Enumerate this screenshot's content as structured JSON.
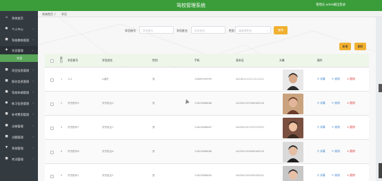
{
  "header": {
    "title": "驾校管理系统",
    "user": "管理员 admin",
    "logout": "退出登录"
  },
  "sidebar": {
    "items": [
      {
        "icon": "home-icon",
        "glyph": "⌂",
        "label": "系统首页",
        "arrow": ""
      },
      {
        "icon": "person-icon",
        "glyph": "●",
        "label": "个人中心",
        "arrow": "›"
      },
      {
        "icon": "book-icon",
        "glyph": "■",
        "label": "驾校教练管理",
        "arrow": "›"
      },
      {
        "icon": "students-icon",
        "glyph": "◆",
        "label": "学员管理",
        "arrow": "⌄"
      },
      {
        "sub": true,
        "label": "学员"
      },
      {
        "icon": "list-icon",
        "glyph": "■",
        "label": "项目信息管理",
        "arrow": "›"
      },
      {
        "icon": "list-icon",
        "glyph": "■",
        "label": "报名信息管理",
        "arrow": "›"
      },
      {
        "icon": "list-icon",
        "glyph": "■",
        "label": "驾校车辆管理",
        "arrow": "›"
      },
      {
        "icon": "pin-icon",
        "glyph": "●",
        "label": "练习信息管理",
        "arrow": "›"
      },
      {
        "icon": "bookmark-icon",
        "glyph": "■",
        "label": "补考费用管理",
        "arrow": "›"
      },
      {
        "icon": "exam-icon",
        "glyph": "■",
        "label": "试卷管理",
        "arrow": "›"
      },
      {
        "icon": "exam-icon",
        "glyph": "■",
        "label": "试题管理",
        "arrow": "›"
      },
      {
        "icon": "settings-icon",
        "glyph": "▼",
        "label": "系统管理",
        "arrow": "›"
      },
      {
        "icon": "exam-icon",
        "glyph": "■",
        "label": "考试管理",
        "arrow": "›"
      }
    ]
  },
  "breadcrumb": {
    "home": "系统首页",
    "sep": "/",
    "current": "学员"
  },
  "search": {
    "fields": [
      {
        "label": "学员账号",
        "placeholder": "学员账号"
      },
      {
        "label": "学员姓名",
        "placeholder": "学员姓名"
      },
      {
        "label": "性别",
        "placeholder": "请选择性别"
      }
    ],
    "button": "查询"
  },
  "actions": {
    "add": "新增",
    "delete": "删除"
  },
  "table": {
    "headers": [
      "索引",
      "学员账号",
      "学员姓名",
      "性别",
      "手机",
      "身份证",
      "头像",
      "操作"
    ],
    "row_actions": {
      "view": "详情",
      "edit": "修改",
      "delete": "删除"
    },
    "rows": [
      {
        "index": "1",
        "account": "111",
        "name": "A演员",
        "gender": "男",
        "phone": "13899999999",
        "id": "441621111111111111"
      },
      {
        "index": "2",
        "account": "学员账号5",
        "name": "学员姓名5",
        "gender": "男",
        "phone": "13823888888",
        "id": "440300199908080000"
      },
      {
        "index": "3",
        "account": "学员账号7",
        "name": "学员姓名7",
        "gender": "男",
        "phone": "13823888887",
        "id": "440300197070707007"
      },
      {
        "index": "4",
        "account": "学员账号6",
        "name": "学员姓名6",
        "gender": "男",
        "phone": "13823888886",
        "id": "440300199606060000"
      },
      {
        "index": "5",
        "account": "学员账号1",
        "name": "学员姓名1",
        "gender": "男",
        "phone": "13823888885",
        "id": "440300199505050001"
      }
    ]
  },
  "colors": {
    "header": "#3a9d3a",
    "sidebar": "#333a40",
    "active_sub": "#5aa65a",
    "button": "#f0b030",
    "danger": "#e04040",
    "link": "#3a80d0"
  }
}
